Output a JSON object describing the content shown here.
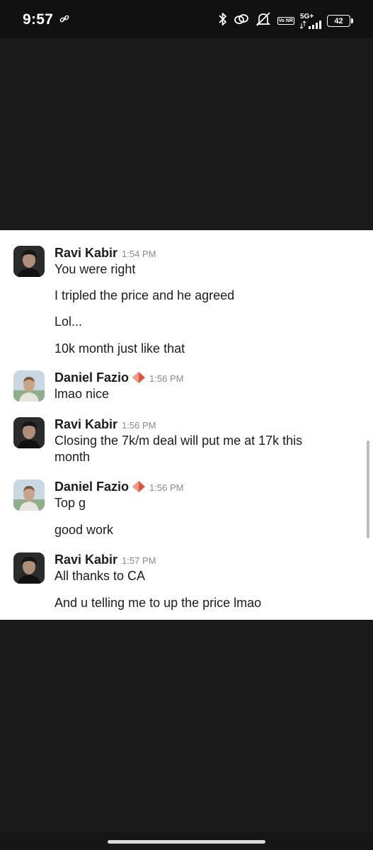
{
  "status_bar": {
    "time": "9:57",
    "network": "5G+",
    "volte": "Vo NR",
    "battery": "42",
    "icons": [
      "link-icon",
      "bluetooth-icon",
      "hotspot-icon",
      "mute-icon",
      "volte-icon",
      "signal-icon",
      "battery-icon"
    ]
  },
  "messages": [
    {
      "sender": "Ravi Kabir",
      "time": "1:54 PM",
      "badge": false,
      "lines": [
        "You were right",
        "I tripled the price and he agreed",
        "Lol...",
        "10k month just like that"
      ]
    },
    {
      "sender": "Daniel Fazio",
      "time": "1:56 PM",
      "badge": true,
      "lines": [
        "lmao nice"
      ]
    },
    {
      "sender": "Ravi Kabir",
      "time": "1:56 PM",
      "badge": false,
      "lines": [
        "Closing the 7k/m deal will put me at 17k this month"
      ]
    },
    {
      "sender": "Daniel Fazio",
      "time": "1:56 PM",
      "badge": true,
      "lines": [
        "Top g",
        "good work"
      ]
    },
    {
      "sender": "Ravi Kabir",
      "time": "1:57 PM",
      "badge": false,
      "lines": [
        "All thanks to CA",
        "And u telling me to up the price lmao"
      ]
    }
  ],
  "colors": {
    "badge": "#e0533a",
    "text": "#1d1c1d",
    "timestamp": "#8a8a8a"
  }
}
